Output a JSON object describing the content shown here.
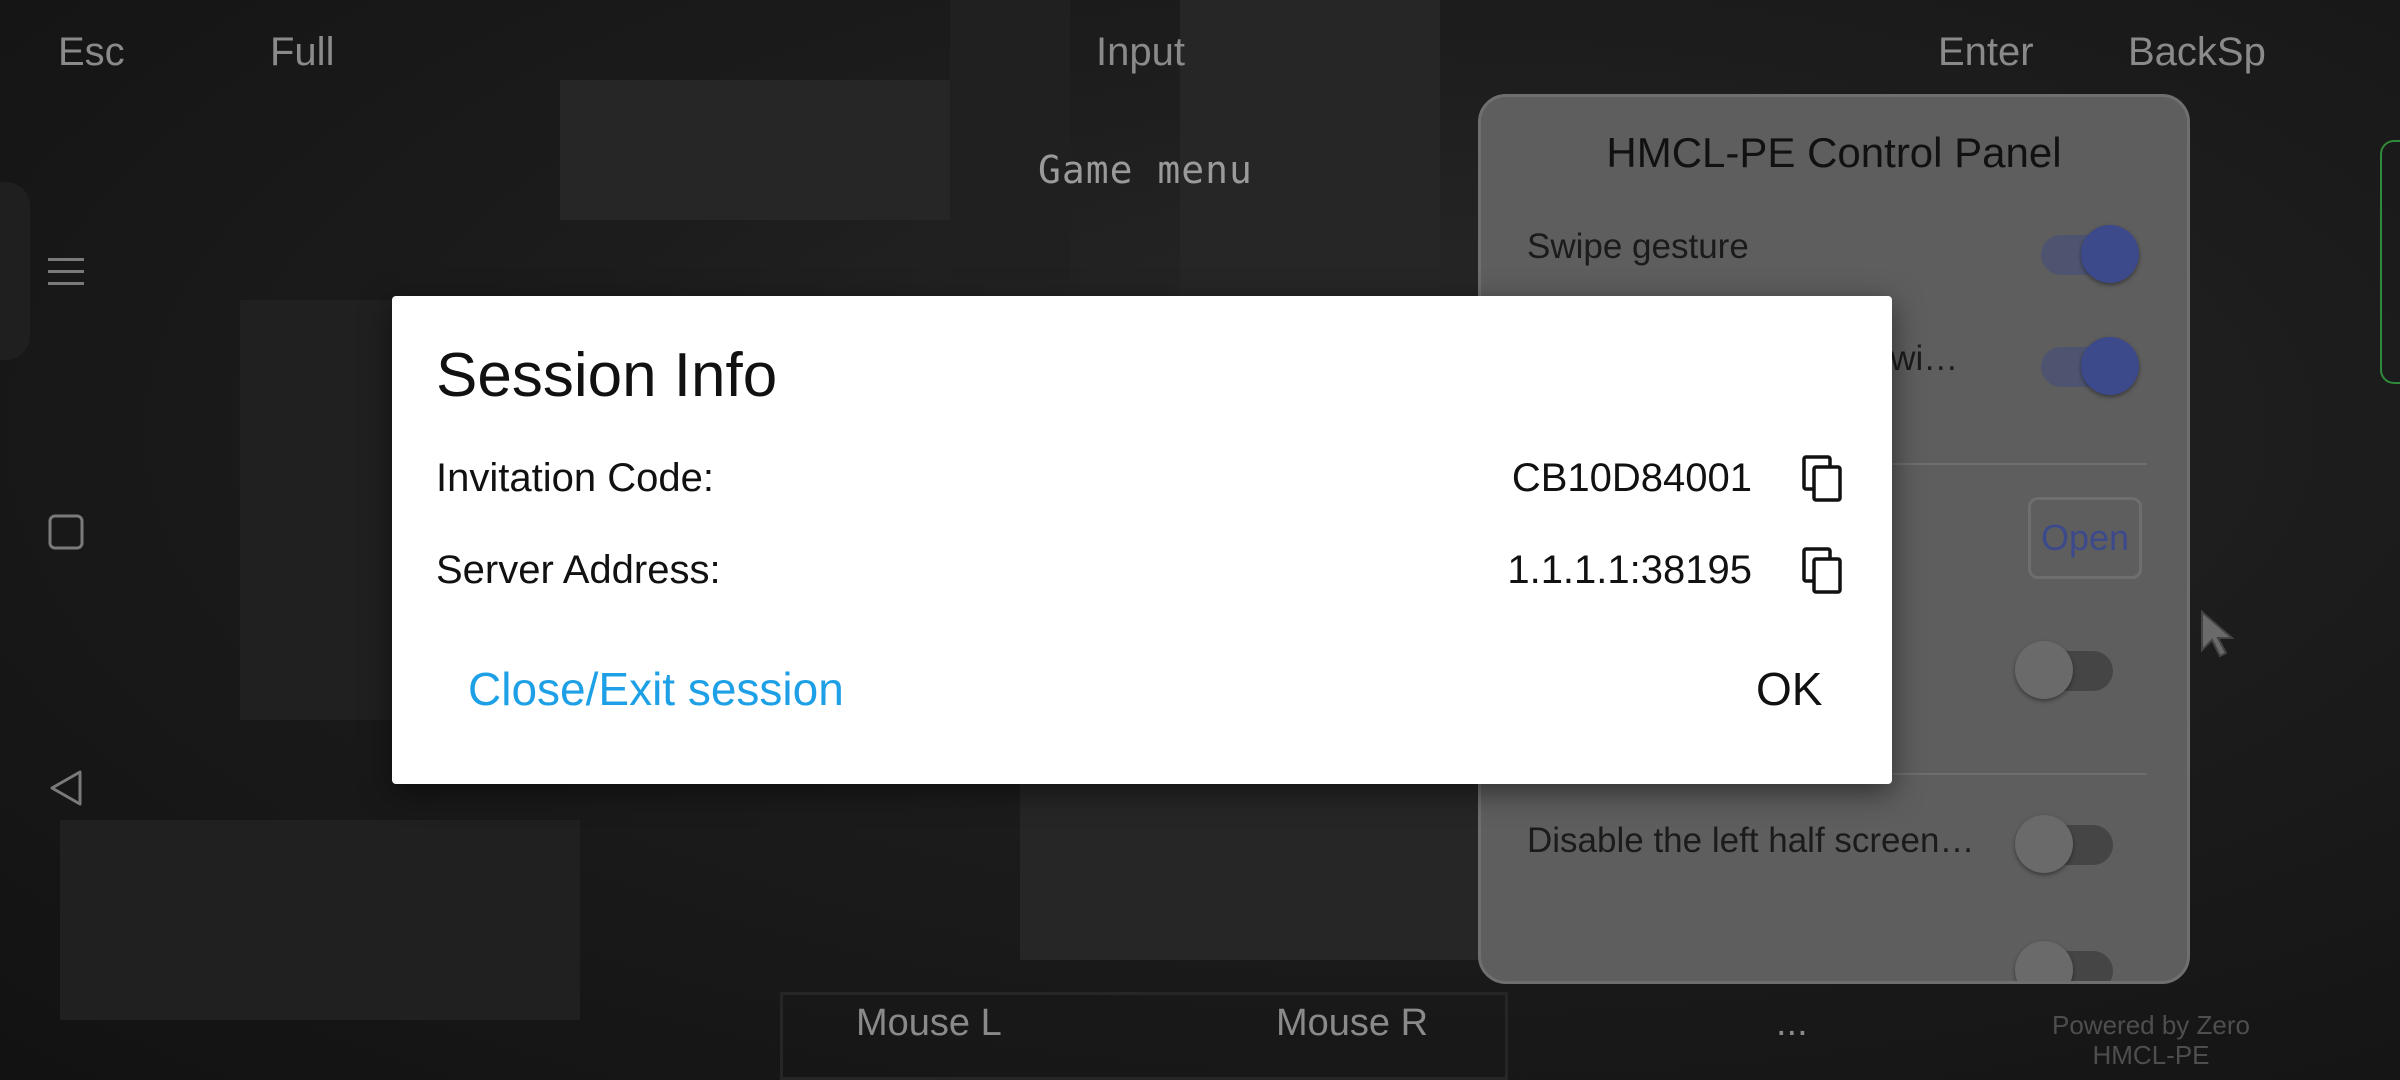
{
  "top_keys": {
    "esc": "Esc",
    "full": "Full",
    "input": "Input",
    "enter": "Enter",
    "backsp": "BackSp"
  },
  "game_menu_label": "Game menu",
  "nav_icons": [
    "menu-icon",
    "square-icon",
    "back-triangle-icon"
  ],
  "control_panel": {
    "title": "HMCL-PE Control Panel",
    "swipe_gesture_label": "Swipe gesture",
    "second_row_label": "g wi…",
    "open_button": "Open",
    "disable_left_half_label": "Disable the left half screen…"
  },
  "toggles": {
    "swipe_gesture": true,
    "second_row": true,
    "third_row": false,
    "disable_left_half": false,
    "partial_row": false
  },
  "bottom_keys": {
    "mouse_l": "Mouse L",
    "mouse_r": "Mouse R",
    "more": "..."
  },
  "powered_by": {
    "line1": "Powered by Zero",
    "line2": "HMCL-PE"
  },
  "dialog": {
    "title": "Session Info",
    "invitation_label": "Invitation Code:",
    "invitation_value": "CB10D84001",
    "server_label": "Server Address:",
    "server_value": "1.1.1.1:38195",
    "close_exit": "Close/Exit session",
    "ok": "OK"
  },
  "colors": {
    "accent_link": "#1ea0e6",
    "toggle_on": "#3c4a8c",
    "panel_bg": "#5e5e5e"
  }
}
